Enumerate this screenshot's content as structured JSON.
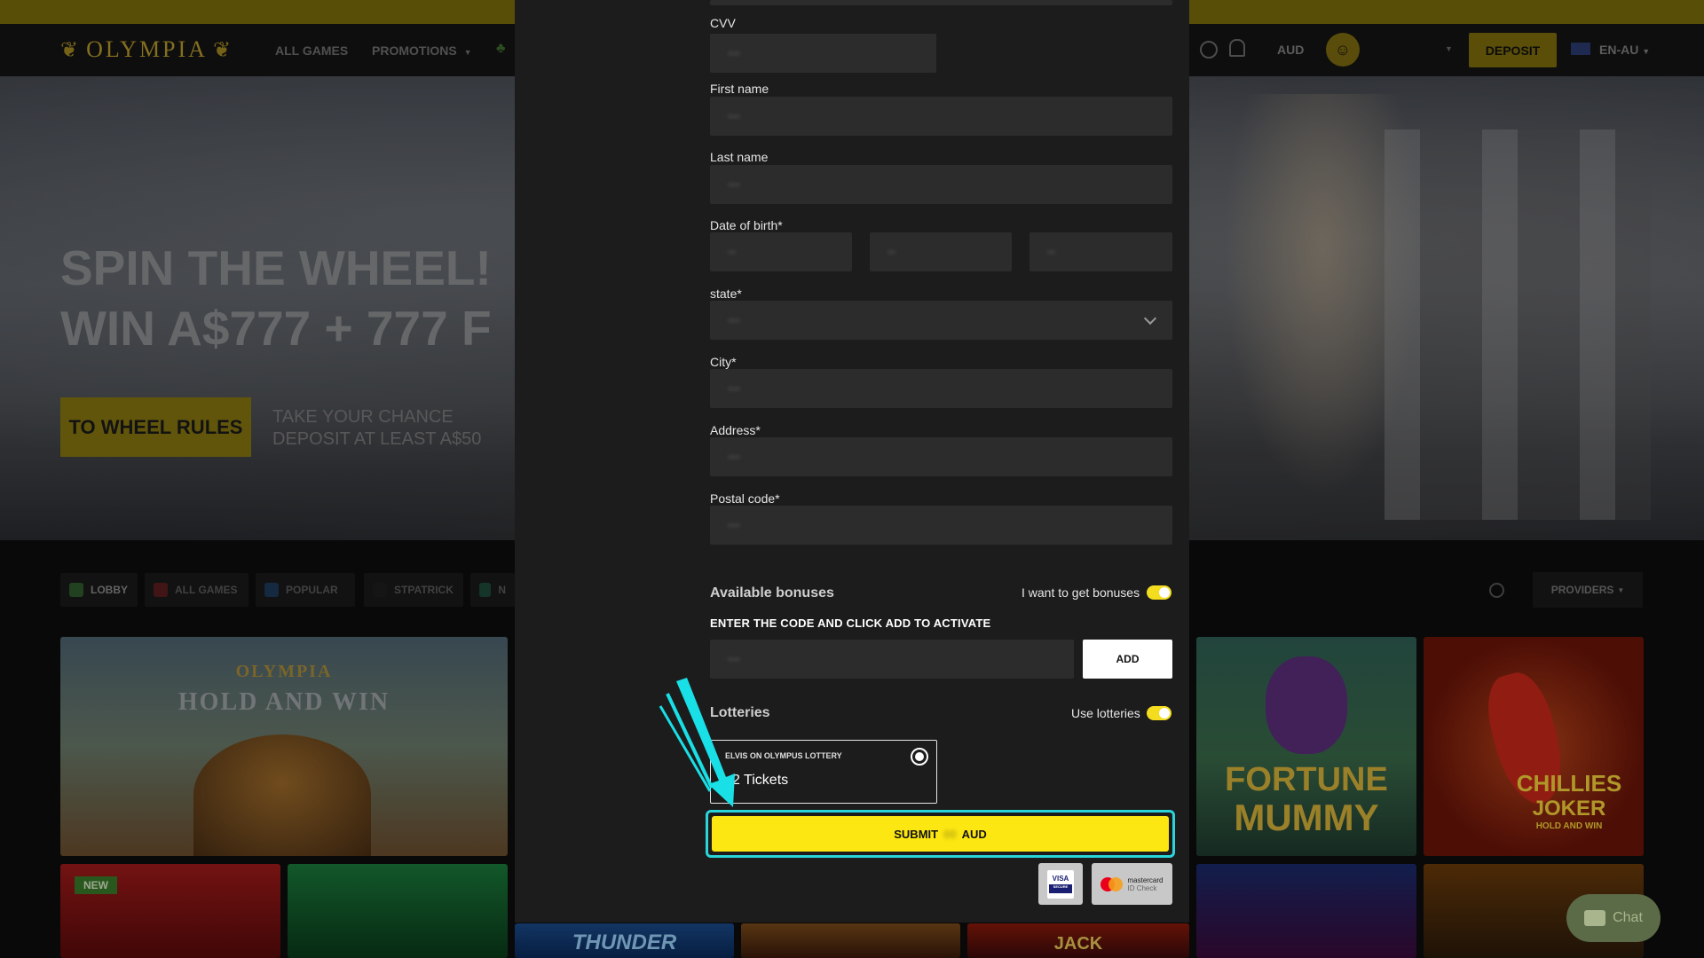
{
  "header": {
    "logo": "OLYMPIA",
    "nav": [
      "ALL GAMES",
      "PROMOTIONS"
    ],
    "currency": "AUD",
    "deposit_label": "DEPOSIT",
    "language": "EN-AU"
  },
  "hero": {
    "title_line1": "SPIN THE WHEEL!",
    "title_line2": "WIN A$777 + 777 F",
    "button_label": "TO WHEEL RULES",
    "sub_line1": "TAKE YOUR CHANCE",
    "sub_line2": "DEPOSIT AT LEAST A$50"
  },
  "categories": [
    "LOBBY",
    "ALL GAMES",
    "POPULAR",
    "STPATRICK",
    "N"
  ],
  "providers_label": "PROVIDERS",
  "tiles": {
    "hold_win_logo": "OLYMPIA",
    "hold_win_title": "HOLD AND WIN",
    "fortune_line1": "FORTUNE",
    "fortune_line2": "MUMMY",
    "chillies_line1": "CHILLIES",
    "chillies_line2": "JOKER",
    "chillies_sub": "HOLD AND WIN",
    "new_badge": "NEW",
    "thunder": "THUNDER",
    "jack": "JACK"
  },
  "form": {
    "cvv_label": "CVV",
    "first_name_label": "First name",
    "last_name_label": "Last name",
    "dob_label": "Date of birth*",
    "state_label": "state*",
    "city_label": "City*",
    "address_label": "Address*",
    "postal_label": "Postal code*"
  },
  "bonuses": {
    "title": "Available bonuses",
    "toggle_label": "I want to get bonuses",
    "toggle_on": true,
    "code_label": "ENTER THE CODE AND CLICK ADD TO ACTIVATE",
    "add_label": "ADD"
  },
  "lotteries": {
    "title": "Lotteries",
    "toggle_label": "Use lotteries",
    "toggle_on": true,
    "card_name": "ELVIS ON OLYMPUS LOTTERY",
    "card_tickets": "2 Tickets"
  },
  "submit": {
    "label": "SUBMIT",
    "currency": "AUD"
  },
  "payments": {
    "visa": "VISA",
    "visa_sub": "SECURE",
    "mc_line1": "mastercard",
    "mc_line2": "ID Check"
  },
  "chat_label": "Chat",
  "colors": {
    "accent_yellow": "#fce713",
    "highlight_cyan": "#2ad4d8",
    "modal_bg": "#1c1c1c",
    "input_bg": "#2c2c2c"
  }
}
